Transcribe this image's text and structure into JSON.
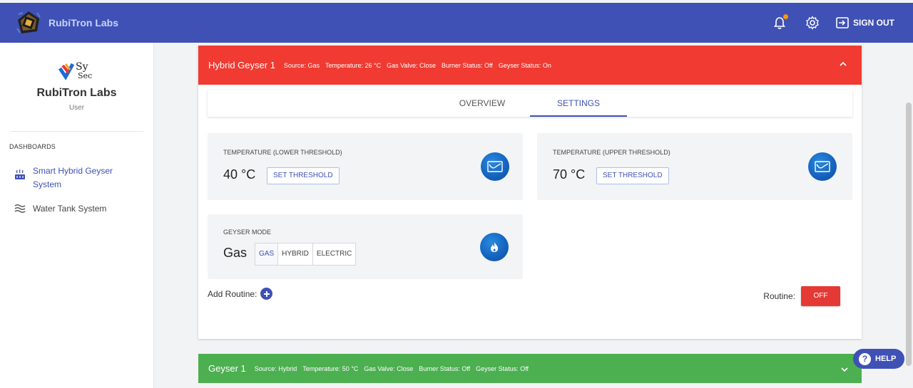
{
  "header": {
    "brand": "RubiTron Labs",
    "icons": [
      "notification-bell-icon",
      "gear-icon",
      "sign-out-icon"
    ],
    "signout_label": "SIGN OUT"
  },
  "sidebar": {
    "org_logo_text": "Sy Sec",
    "org_name": "RubiTron Labs",
    "role": "User",
    "section_title": "DASHBOARDS",
    "items": [
      {
        "label": "Smart Hybrid Geyser System",
        "icon": "geyser-icon",
        "active": true
      },
      {
        "label": "Water Tank System",
        "icon": "waves-icon",
        "active": false
      }
    ]
  },
  "geyser_main": {
    "title": "Hybrid Geyser 1",
    "attributes": [
      "Source: Gas",
      "Temperature: 26 °C",
      "Gas Valve: Close",
      "Burner Status: Off",
      "Geyser Status: On"
    ],
    "tabs": [
      "OVERVIEW",
      "SETTINGS"
    ],
    "active_tab": "SETTINGS",
    "lower_threshold": {
      "title": "TEMPERATURE (LOWER THRESHOLD)",
      "value": "40 °C",
      "button": "SET THRESHOLD",
      "icon": "thermometer-chart-icon"
    },
    "upper_threshold": {
      "title": "TEMPERATURE (UPPER THRESHOLD)",
      "value": "70 °C",
      "button": "SET THRESHOLD",
      "icon": "thermometer-chart-icon"
    },
    "mode": {
      "title": "GEYSER MODE",
      "value": "Gas",
      "options": [
        "GAS",
        "HYBRID",
        "ELECTRIC"
      ],
      "selected": "GAS",
      "icon": "flame-icon"
    },
    "add_routine_label": "Add Routine:",
    "routine_label": "Routine:",
    "routine_state": "OFF"
  },
  "geyser_second": {
    "title": "Geyser 1",
    "attributes": [
      "Source: Hybrid",
      "Temperature: 50 °C",
      "Gas Valve: Close",
      "Burner Status: Off",
      "Geyser Status: Off"
    ]
  },
  "help_label": "HELP",
  "colors": {
    "header": "#3f51b5",
    "active_bar": "#f03a32",
    "inactive_bar": "#4caf50",
    "accent": "#3f51b5",
    "off_button": "#e53935"
  }
}
